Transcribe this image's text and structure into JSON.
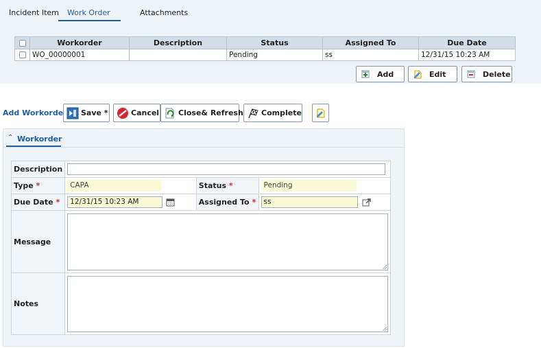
{
  "tabs": [
    {
      "label": "Incident Item"
    },
    {
      "label": "Work Order"
    },
    {
      "label": "Attachments"
    }
  ],
  "grid": {
    "columns": [
      "Workorder",
      "Description",
      "Status",
      "Assigned To",
      "Due Date"
    ],
    "rows": [
      {
        "workorder": "WO_00000001",
        "description": "",
        "status": "Pending",
        "assigned_to": "ss",
        "due_date": "12/31/15 10:23 AM"
      }
    ],
    "buttons": {
      "add": "Add",
      "edit": "Edit",
      "delete": "Delete"
    }
  },
  "toolbar": {
    "label": "Add Workorder",
    "save": "Save *",
    "cancel": "Cancel",
    "close_refresh": "Close& Refresh",
    "complete": "Complete"
  },
  "form": {
    "section_title": "Workorder",
    "required_mark": "*",
    "description": {
      "label": "Description",
      "value": ""
    },
    "type": {
      "label": "Type",
      "value": "CAPA"
    },
    "status": {
      "label": "Status",
      "value": "Pending"
    },
    "due_date": {
      "label": "Due Date",
      "value": "12/31/15 10:23 AM"
    },
    "assigned_to": {
      "label": "Assigned To",
      "value": "ss"
    },
    "message": {
      "label": "Message",
      "value": ""
    },
    "notes": {
      "label": "Notes",
      "value": ""
    }
  },
  "colors": {
    "accent": "#1e5fa3",
    "panel_bg": "#eef3f8",
    "header_bg": "#d3dde8",
    "required": "#d8262e",
    "readonly_bg": "#fbf8d6"
  }
}
